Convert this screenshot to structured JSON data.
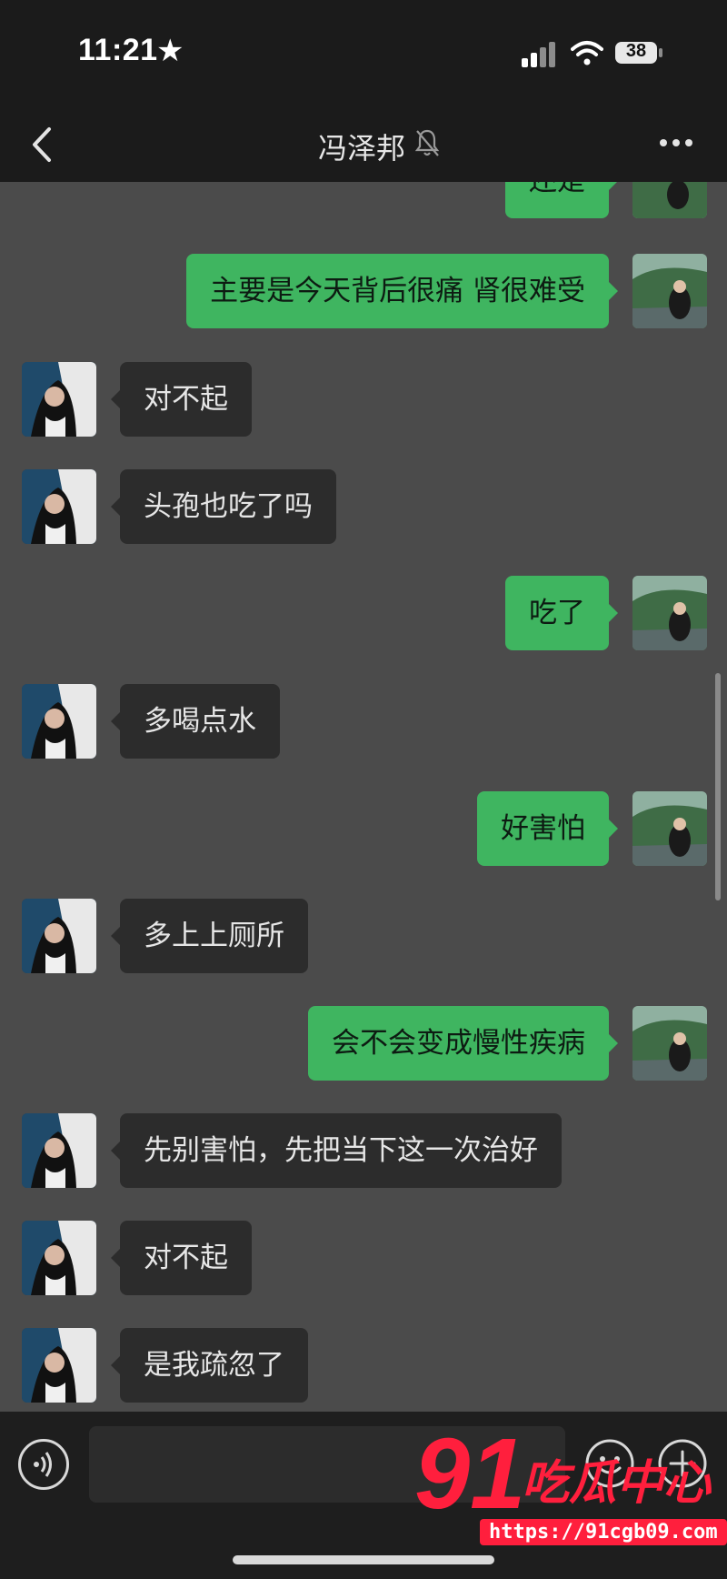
{
  "status_bar": {
    "time": "11:21",
    "battery": "38"
  },
  "navbar": {
    "title": "冯泽邦"
  },
  "messages": [
    {
      "side": "me",
      "text": "还是"
    },
    {
      "side": "me",
      "text": "主要是今天背后很痛 肾很难受"
    },
    {
      "side": "other",
      "text": "对不起"
    },
    {
      "side": "other",
      "text": "头孢也吃了吗"
    },
    {
      "side": "me",
      "text": "吃了"
    },
    {
      "side": "other",
      "text": "多喝点水"
    },
    {
      "side": "me",
      "text": "好害怕"
    },
    {
      "side": "other",
      "text": "多上上厕所"
    },
    {
      "side": "me",
      "text": "会不会变成慢性疾病"
    },
    {
      "side": "other",
      "text": "先别害怕，先把当下这一次治好"
    },
    {
      "side": "other",
      "text": "对不起"
    },
    {
      "side": "other",
      "text": "是我疏忽了"
    }
  ],
  "input": {
    "placeholder": ""
  },
  "watermark": {
    "number": "91",
    "brand": "吃瓜中心",
    "url": "https://91cgb09.com"
  }
}
